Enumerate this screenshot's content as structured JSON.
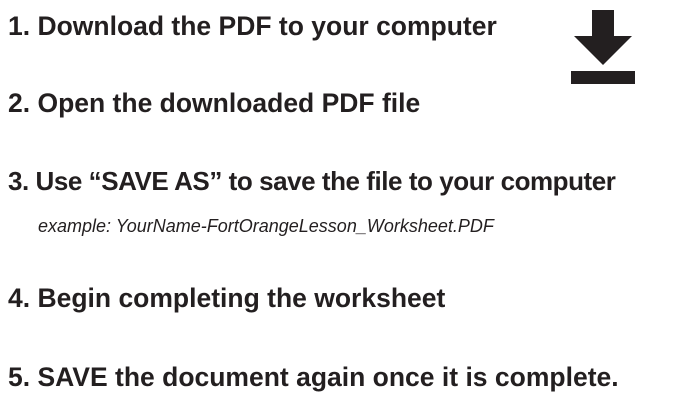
{
  "steps": [
    {
      "text": "1. Download the PDF to your computer"
    },
    {
      "text": "2. Open the downloaded PDF file"
    },
    {
      "text": "3. Use “SAVE AS” to save the file to your computer"
    },
    {
      "text": "4. Begin completing the worksheet"
    },
    {
      "text": "5. SAVE the document again once it is complete."
    }
  ],
  "example": "example: YourName-FortOrangeLesson_Worksheet.PDF",
  "icon": {
    "name": "download-icon",
    "color": "#231f20"
  }
}
